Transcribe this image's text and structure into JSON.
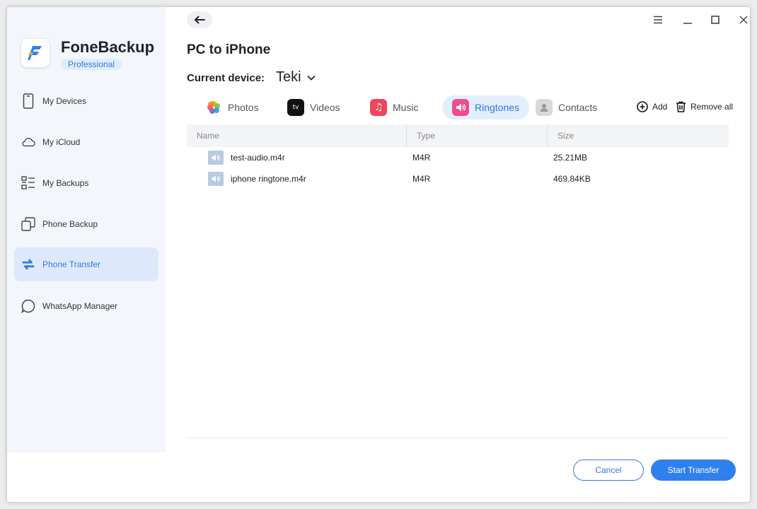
{
  "app": {
    "name": "FoneBackup",
    "edition": "Professional"
  },
  "sidebar": {
    "items": [
      {
        "label": "My Devices",
        "icon": "phone-icon",
        "active": false
      },
      {
        "label": "My iCloud",
        "icon": "cloud-icon",
        "active": false
      },
      {
        "label": "My Backups",
        "icon": "list-icon",
        "active": false
      },
      {
        "label": "Phone Backup",
        "icon": "copy-icon",
        "active": false
      },
      {
        "label": "Phone Transfer",
        "icon": "transfer-icon",
        "active": true
      },
      {
        "label": "WhatsApp Manager",
        "icon": "chat-bubble-icon",
        "active": false
      }
    ]
  },
  "header": {
    "title": "PC to iPhone"
  },
  "device": {
    "label": "Current device:",
    "name": "Teki"
  },
  "tabs": [
    {
      "label": "Photos",
      "icon": "photos-icon",
      "active": false
    },
    {
      "label": "Videos",
      "icon": "apple-tv-icon",
      "active": false
    },
    {
      "label": "Music",
      "icon": "music-icon",
      "active": false
    },
    {
      "label": "Ringtones",
      "icon": "speaker-icon",
      "active": true
    },
    {
      "label": "Contacts",
      "icon": "contacts-icon",
      "active": false
    }
  ],
  "actions": {
    "add": "Add",
    "remove_all": "Remove all"
  },
  "table": {
    "columns": [
      "Name",
      "Type",
      "Size"
    ],
    "rows": [
      {
        "name": "test-audio.m4r",
        "type": "M4R",
        "size": "25.21MB"
      },
      {
        "name": "iphone ringtone.m4r",
        "type": "M4R",
        "size": "469.84KB"
      }
    ]
  },
  "footer": {
    "cancel": "Cancel",
    "start": "Start Transfer"
  },
  "colors": {
    "accent": "#2f7ae5",
    "sidebar_bg": "#f3f6fb",
    "active_bg": "#dde9fb"
  }
}
